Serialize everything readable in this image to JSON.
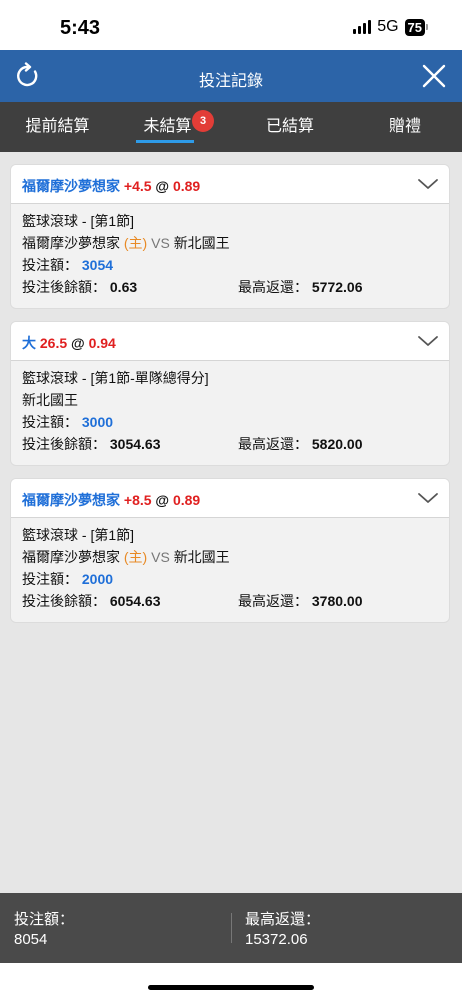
{
  "status_bar": {
    "time": "5:43",
    "network": "5G",
    "battery": "75"
  },
  "header": {
    "title": "投注記錄",
    "refresh_icon": "refresh-icon",
    "close_icon": "close-icon"
  },
  "tabs": [
    {
      "label": "提前結算",
      "active": false
    },
    {
      "label": "未結算",
      "active": true,
      "badge": "3"
    },
    {
      "label": "已結算",
      "active": false
    },
    {
      "label": "贈禮",
      "active": false
    }
  ],
  "bets": [
    {
      "selection": "福爾摩沙夢想家",
      "line": "+4.5",
      "at": "@",
      "odds": "0.89",
      "market": "籃球滾球 - [第1節]",
      "match_home": "福爾摩沙夢想家",
      "home_tag": "(主)",
      "vs": "VS",
      "match_away": "新北國王",
      "stake_label": "投注額：",
      "stake": "3054",
      "balance_label": "投注後餘額：",
      "balance": "0.63",
      "max_return_label": "最高返還：",
      "max_return": "5772.06"
    },
    {
      "selection": "大",
      "line": "26.5",
      "at": "@",
      "odds": "0.94",
      "market": "籃球滾球 - [第1節-單隊總得分]",
      "team": "新北國王",
      "stake_label": "投注額：",
      "stake": "3000",
      "balance_label": "投注後餘額：",
      "balance": "3054.63",
      "max_return_label": "最高返還：",
      "max_return": "5820.00"
    },
    {
      "selection": "福爾摩沙夢想家",
      "line": "+8.5",
      "at": "@",
      "odds": "0.89",
      "market": "籃球滾球 - [第1節]",
      "match_home": "福爾摩沙夢想家",
      "home_tag": "(主)",
      "vs": "VS",
      "match_away": "新北國王",
      "stake_label": "投注額：",
      "stake": "2000",
      "balance_label": "投注後餘額：",
      "balance": "6054.63",
      "max_return_label": "最高返還：",
      "max_return": "3780.00"
    }
  ],
  "footer": {
    "total_stake_label": "投注額：",
    "total_stake": "8054",
    "total_return_label": "最高返還：",
    "total_return": "15372.06"
  },
  "colors": {
    "header_bg": "#2c64a8",
    "tabs_bg": "#3f3f3f",
    "accent_blue": "#1f6fd8",
    "odds_red": "#e02020",
    "home_orange": "#e88a25",
    "badge_red": "#e23d37"
  }
}
